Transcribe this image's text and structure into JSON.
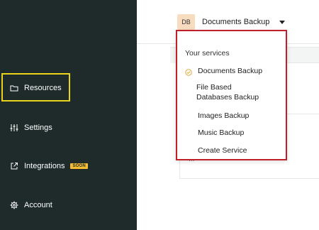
{
  "sidebar": {
    "items": [
      {
        "label": "Resources",
        "icon": "folder-icon"
      },
      {
        "label": "Settings",
        "icon": "sliders-icon"
      },
      {
        "label": "Integrations",
        "icon": "external-link-icon",
        "badge": "SOON"
      },
      {
        "label": "Account",
        "icon": "gear-icon"
      }
    ]
  },
  "header": {
    "avatar_initials": "DB",
    "selected_service": "Documents Backup"
  },
  "dropdown": {
    "heading": "Your services",
    "items": [
      {
        "label": "Documents Backup",
        "selected": true
      },
      {
        "label": "File Based\nDatabases Backup"
      },
      {
        "label": "Images Backup"
      },
      {
        "label": "Music Backup"
      },
      {
        "label": "Create Service"
      }
    ]
  },
  "main": {
    "ellipsis": "..."
  },
  "colors": {
    "sidebar_bg": "#1f2b2b",
    "highlight_yellow": "#ead41b",
    "dropdown_border_red": "#c0202a",
    "soon_badge": "#f5bd2f",
    "check_orange": "#e0a93a",
    "avatar_bg": "#f7dcc0"
  }
}
